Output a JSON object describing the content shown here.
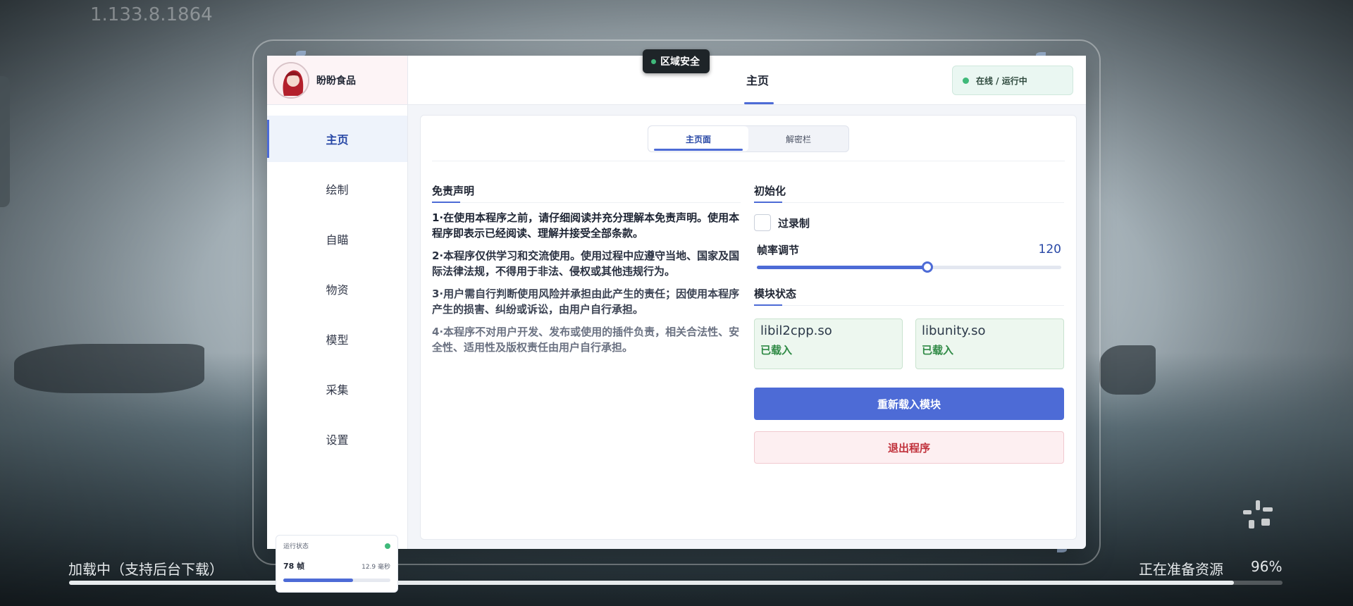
{
  "background": {
    "version": "1.133.8.1864",
    "loading_text": "加载中（支持后台下载）",
    "preparing_text": "正在准备资源",
    "loading_percent": "96%",
    "loading_progress": 0.96
  },
  "badge": {
    "label": "区域安全",
    "dot_color": "#3fb97a"
  },
  "brand": {
    "name": "盼盼食品"
  },
  "header": {
    "title": "主页",
    "status": "在线 / 运行中",
    "status_dot_color": "#3fb97a"
  },
  "sidebar": {
    "items": [
      {
        "label": "主页",
        "active": true
      },
      {
        "label": "绘制",
        "active": false
      },
      {
        "label": "自瞄",
        "active": false
      },
      {
        "label": "物资",
        "active": false
      },
      {
        "label": "模型",
        "active": false
      },
      {
        "label": "采集",
        "active": false
      },
      {
        "label": "设置",
        "active": false
      }
    ],
    "run_card": {
      "label": "运行状态",
      "fps": "78 帧",
      "ms": "12.9 毫秒",
      "progress": 0.65
    }
  },
  "tabs": [
    {
      "label": "主页面",
      "active": true
    },
    {
      "label": "解密栏",
      "active": false
    }
  ],
  "disclaimer": {
    "title": "免责声明",
    "items": [
      "1·在使用本程序之前，请仔细阅读并充分理解本免责声明。使用本程序即表示已经阅读、理解并接受全部条款。",
      "2·本程序仅供学习和交流使用。使用过程中应遵守当地、国家及国际法律法规，不得用于非法、侵权或其他违规行为。",
      "3·用户需自行判断使用风险并承担由此产生的责任；因使用本程序产生的损害、纠纷或诉讼，由用户自行承担。",
      "4·本程序不对用户开发、发布或使用的插件负责，相关合法性、安全性、适用性及版权责任由用户自行承担。"
    ]
  },
  "init": {
    "title": "初始化",
    "checkbox_label": "过录制",
    "checked": false,
    "slider_label": "帧率调节",
    "slider_value": "120",
    "slider_fraction": 0.56
  },
  "modules": {
    "title": "模块状态",
    "items": [
      {
        "name": "libil2cpp.so",
        "state": "已载入"
      },
      {
        "name": "libunity.so",
        "state": "已载入"
      }
    ],
    "reload_label": "重新载入模块",
    "exit_label": "退出程序"
  }
}
